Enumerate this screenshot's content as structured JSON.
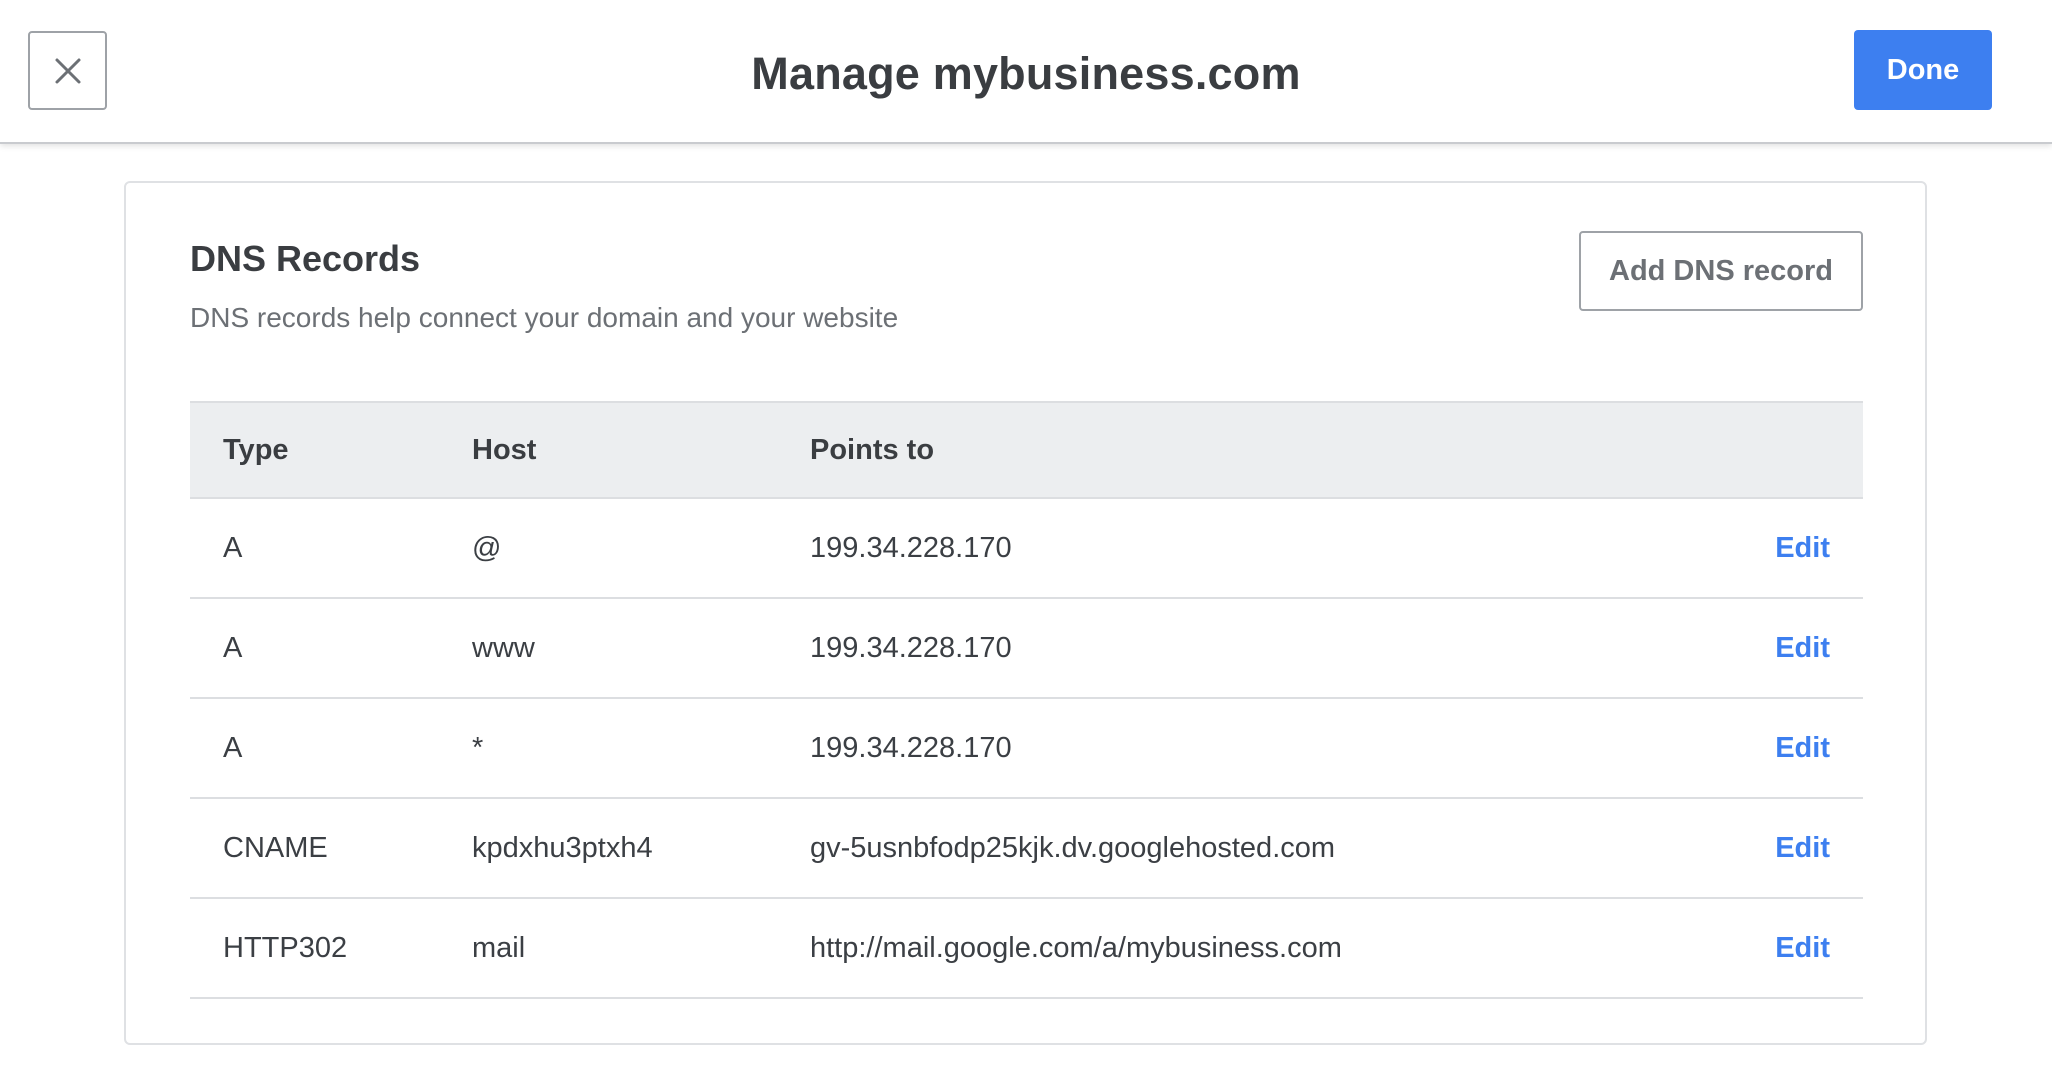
{
  "header": {
    "close_icon": "close-icon",
    "title": "Manage mybusiness.com",
    "done_label": "Done",
    "accent_color": "#3d7ff0"
  },
  "dns": {
    "title": "DNS Records",
    "subtitle": "DNS records help connect your domain and your website",
    "add_label": "Add DNS record",
    "columns": {
      "type": "Type",
      "host": "Host",
      "points_to": "Points to"
    },
    "rows": [
      {
        "type": "A",
        "host": "@",
        "points_to": "199.34.228.170",
        "action": "Edit"
      },
      {
        "type": "A",
        "host": "www",
        "points_to": "199.34.228.170",
        "action": "Edit"
      },
      {
        "type": "A",
        "host": "*",
        "points_to": "199.34.228.170",
        "action": "Edit"
      },
      {
        "type": "CNAME",
        "host": "kpdxhu3ptxh4",
        "points_to": "gv-5usnbfodp25kjk.dv.googlehosted.com",
        "action": "Edit"
      },
      {
        "type": "HTTP302",
        "host": "mail",
        "points_to": "http://mail.google.com/a/mybusiness.com",
        "action": "Edit"
      }
    ]
  }
}
